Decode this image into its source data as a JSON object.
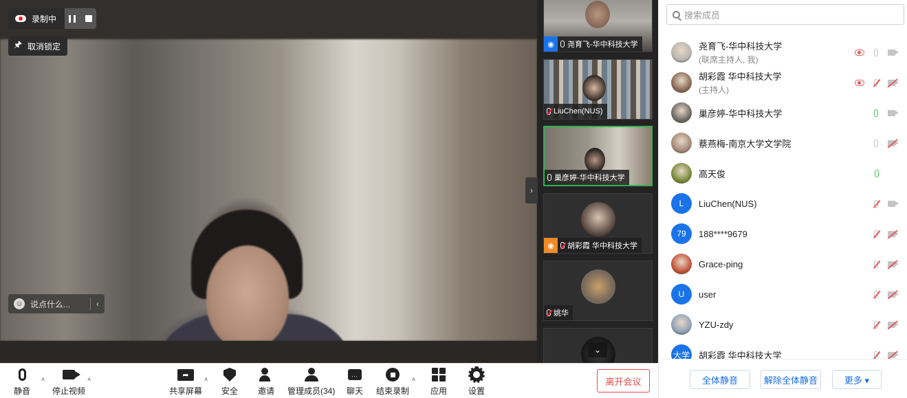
{
  "recording": {
    "label": "录制中"
  },
  "unpin": {
    "label": "取消锁定"
  },
  "chat_input": {
    "placeholder": "说点什么..."
  },
  "thumbnails": [
    {
      "name": "尧育飞-华中科技大学",
      "role": "host",
      "mic": "on",
      "active": false
    },
    {
      "name": "LiuChen(NUS)",
      "role": "none",
      "mic": "muted",
      "active": false
    },
    {
      "name": "巢彦婷-华中科技大学",
      "role": "none",
      "mic": "on",
      "active": true
    },
    {
      "name": "胡彩霞 华中科技大学",
      "role": "cohost",
      "mic": "muted",
      "active": false
    },
    {
      "name": "姚华",
      "role": "none",
      "mic": "muted",
      "active": false
    }
  ],
  "toolbar": {
    "mute": "静音",
    "stop_video": "停止视频",
    "share_screen": "共享屏幕",
    "security": "安全",
    "invite": "邀请",
    "manage_members": "管理成员(34)",
    "chat": "聊天",
    "end_recording": "结束录制",
    "apps": "应用",
    "settings": "设置",
    "leave": "离开会议"
  },
  "panel": {
    "search_placeholder": "搜索成员",
    "members": [
      {
        "name": "尧育飞-华中科技大学",
        "sub": "(联席主持人, 我)",
        "avatar": {
          "type": "photo",
          "color": "#b9b6b1"
        },
        "rec": true,
        "mic": "off",
        "cam": "on"
      },
      {
        "name": "胡彩霞 华中科技大学",
        "sub": "(主持人)",
        "avatar": {
          "type": "photo",
          "color": "#8a6a55"
        },
        "rec": true,
        "mic": "muted",
        "cam": "off"
      },
      {
        "name": "巢彦婷-华中科技大学",
        "sub": "",
        "avatar": {
          "type": "photo",
          "color": "#6e6a66"
        },
        "rec": false,
        "mic": "on",
        "cam": "on"
      },
      {
        "name": "蔡燕梅-南京大学文学院",
        "sub": "",
        "avatar": {
          "type": "photo",
          "color": "#a58a7a"
        },
        "rec": false,
        "mic": "off",
        "cam": "off"
      },
      {
        "name": "高天俊",
        "sub": "",
        "avatar": {
          "type": "photo",
          "color": "#7a8a3a"
        },
        "rec": false,
        "mic": "on",
        "cam": "none"
      },
      {
        "name": "LiuChen(NUS)",
        "sub": "",
        "avatar": {
          "type": "letter",
          "text": "L",
          "color": "#1a73e8"
        },
        "rec": false,
        "mic": "muted",
        "cam": "on"
      },
      {
        "name": "188****9679",
        "sub": "",
        "avatar": {
          "type": "letter",
          "text": "79",
          "color": "#1a73e8"
        },
        "rec": false,
        "mic": "muted",
        "cam": "off"
      },
      {
        "name": "Grace-ping",
        "sub": "",
        "avatar": {
          "type": "photo",
          "color": "#c2553a"
        },
        "rec": false,
        "mic": "muted",
        "cam": "off"
      },
      {
        "name": "user",
        "sub": "",
        "avatar": {
          "type": "letter",
          "text": "U",
          "color": "#1a73e8"
        },
        "rec": false,
        "mic": "muted",
        "cam": "off"
      },
      {
        "name": "YZU-zdy",
        "sub": "",
        "avatar": {
          "type": "photo",
          "color": "#8fa3b5"
        },
        "rec": false,
        "mic": "muted",
        "cam": "off"
      },
      {
        "name": "胡彩霞 华中科技大学",
        "sub": "",
        "avatar": {
          "type": "letter",
          "text": "大学",
          "color": "#1a73e8"
        },
        "rec": false,
        "mic": "muted",
        "cam": "off"
      }
    ],
    "footer": {
      "mute_all": "全体静音",
      "unmute_all": "解除全体静音",
      "more": "更多 ▾"
    }
  }
}
